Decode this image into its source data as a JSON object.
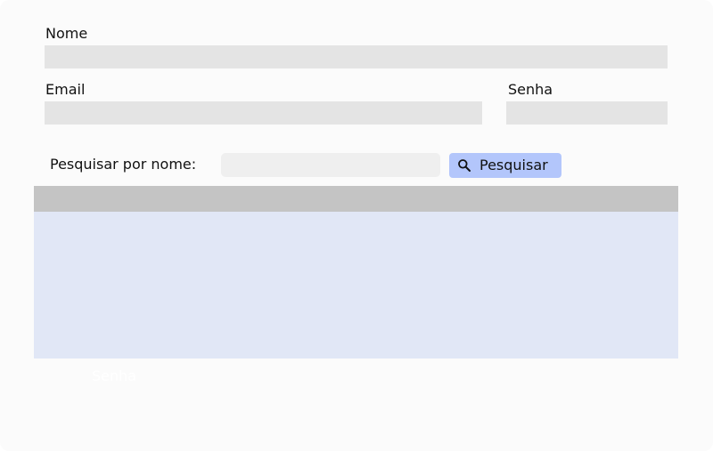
{
  "form": {
    "nome_label": "Nome",
    "nome_value": "",
    "email_label": "Email",
    "email_value": "",
    "senha_label": "Senha",
    "senha_value": ""
  },
  "search": {
    "label": "Pesquisar por nome:",
    "value": "",
    "button_label": "Pesquisar",
    "button_icon": "search-icon"
  },
  "table": {
    "columns": [],
    "rows": []
  },
  "footer": {
    "ghost_label": "Senha"
  },
  "colors": {
    "panel_background": "#fbfbfb",
    "field_background": "#e4e4e4",
    "search_field_background": "#efefef",
    "button_background": "#b3c6fb",
    "table_header": "#c4c4c4",
    "table_body": "#e1e7f6"
  }
}
